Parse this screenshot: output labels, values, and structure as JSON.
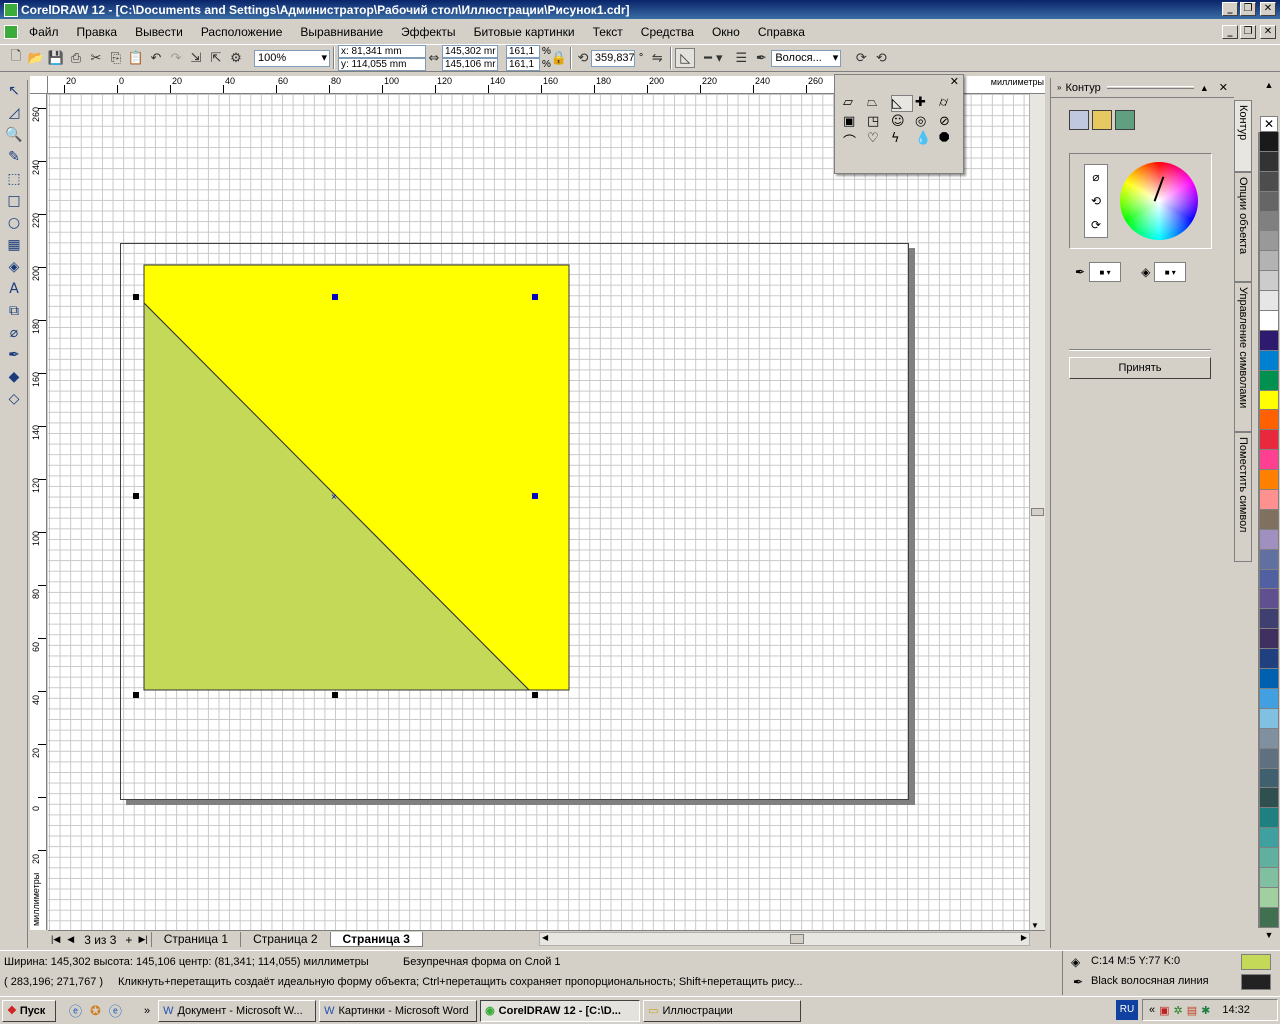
{
  "window": {
    "title": "CorelDRAW 12 - [C:\\Documents and Settings\\Администратор\\Рабочий стол\\Иллюстрации\\Рисунок1.cdr]"
  },
  "menu": [
    "Файл",
    "Правка",
    "Вывести",
    "Расположение",
    "Выравнивание",
    "Эффекты",
    "Битовые картинки",
    "Текст",
    "Средства",
    "Окно",
    "Справка"
  ],
  "toolbar": {
    "zoom": "100%"
  },
  "propbar": {
    "x": "x: 81,341 mm",
    "y": "y: 114,055 mm",
    "w": "145,302 mr",
    "h": "145,106 mr",
    "sx": "161,1",
    "sy": "161,1",
    "pct1": "%",
    "pct2": "%",
    "angle": "359,837",
    "deg": "°",
    "outline": "Волося..."
  },
  "rulers": {
    "units": "миллиметры",
    "h_ticks": [
      "20",
      "0",
      "20",
      "40",
      "60",
      "80",
      "100",
      "120",
      "140",
      "160",
      "180",
      "200",
      "220",
      "240",
      "260"
    ],
    "v_ticks": [
      "260",
      "240",
      "220",
      "200",
      "180",
      "160",
      "140",
      "120",
      "100",
      "80",
      "60",
      "40",
      "20",
      "0",
      "20"
    ],
    "v_unit_label": "миллиметры"
  },
  "pages": {
    "counter": "3 из 3",
    "tabs": [
      "Страница 1",
      "Страница 2",
      "Страница 3"
    ],
    "active": 2
  },
  "status": {
    "line1": "Ширина: 145,302  высота: 145,106  центр: (81,341; 114,055)  миллиметры",
    "object": "Безупречная форма on Слой 1",
    "line2": "( 283,196; 271,767 )",
    "hint": "Кликнуть+перетащить создаёт идеальную форму объекта; Ctrl+перетащить  сохраняет пропорциональность; Shift+перетащить рису...",
    "fill": "C:14 M:5 Y:77 K:0",
    "fill_color": "#c4d957",
    "outline": "Black  волосяная линия",
    "outline_color": "#222222"
  },
  "docker": {
    "title": "Контур",
    "apply": "Принять",
    "tabs": [
      "Контур",
      "Опции объекта",
      "Управление символами",
      "Поместить символ"
    ]
  },
  "drawing": {
    "yellow": "#ffff00",
    "green": "#c4d957"
  },
  "palette": [
    "#1a1a1a",
    "#333333",
    "#4d4d4d",
    "#666666",
    "#808080",
    "#999999",
    "#b3b3b3",
    "#cccccc",
    "#e6e6e6",
    "#ffffff",
    "#2e1a6e",
    "#0080d0",
    "#009050",
    "#ffff00",
    "#ff6000",
    "#e8283c",
    "#ff4090",
    "#ff8000",
    "#ff9090",
    "#807060",
    "#a090c0",
    "#6070a0",
    "#5060a0",
    "#605090",
    "#404070",
    "#403060",
    "#204080",
    "#0060b0",
    "#40a0e0",
    "#80c0e0",
    "#8090a0",
    "#607080",
    "#406070",
    "#305050",
    "#208080",
    "#40a0a0",
    "#60b0a0",
    "#80c0a0",
    "#a0d0a0",
    "#407050"
  ],
  "taskbar": {
    "start": "Пуск",
    "tasks": [
      "Документ - Microsoft W...",
      "Картинки - Microsoft Word",
      "CorelDRAW 12 - [C:\\D...",
      "Иллюстрации"
    ],
    "lang": "RU",
    "clock": "14:32"
  }
}
